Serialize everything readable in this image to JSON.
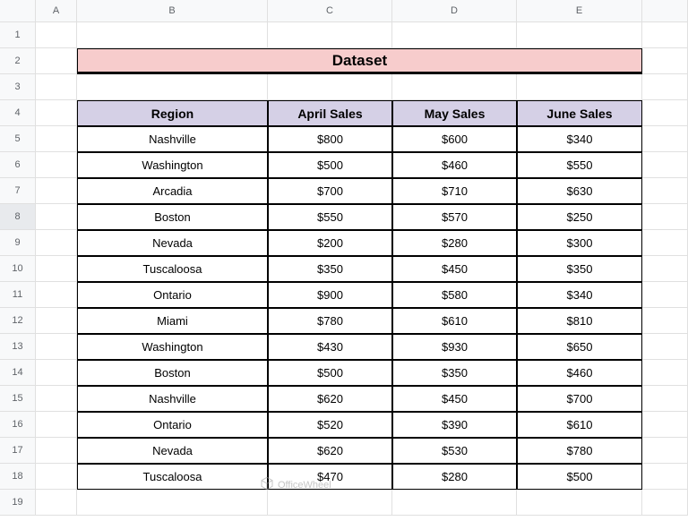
{
  "columns": [
    "A",
    "B",
    "C",
    "D",
    "E"
  ],
  "row_count": 19,
  "selected_row": 8,
  "title": "Dataset",
  "chart_data": {
    "type": "table",
    "headers": [
      "Region",
      "April Sales",
      "May Sales",
      "June Sales"
    ],
    "rows": [
      [
        "Nashville",
        "$800",
        "$600",
        "$340"
      ],
      [
        "Washington",
        "$500",
        "$460",
        "$550"
      ],
      [
        "Arcadia",
        "$700",
        "$710",
        "$630"
      ],
      [
        "Boston",
        "$550",
        "$570",
        "$250"
      ],
      [
        "Nevada",
        "$200",
        "$280",
        "$300"
      ],
      [
        "Tuscaloosa",
        "$350",
        "$450",
        "$350"
      ],
      [
        "Ontario",
        "$900",
        "$580",
        "$340"
      ],
      [
        "Miami",
        "$780",
        "$610",
        "$810"
      ],
      [
        "Washington",
        "$430",
        "$930",
        "$650"
      ],
      [
        "Boston",
        "$500",
        "$350",
        "$460"
      ],
      [
        "Nashville",
        "$620",
        "$450",
        "$700"
      ],
      [
        "Ontario",
        "$520",
        "$390",
        "$610"
      ],
      [
        "Nevada",
        "$620",
        "$530",
        "$780"
      ],
      [
        "Tuscaloosa",
        "$470",
        "$280",
        "$500"
      ]
    ]
  },
  "watermark": "OfficeWheel"
}
